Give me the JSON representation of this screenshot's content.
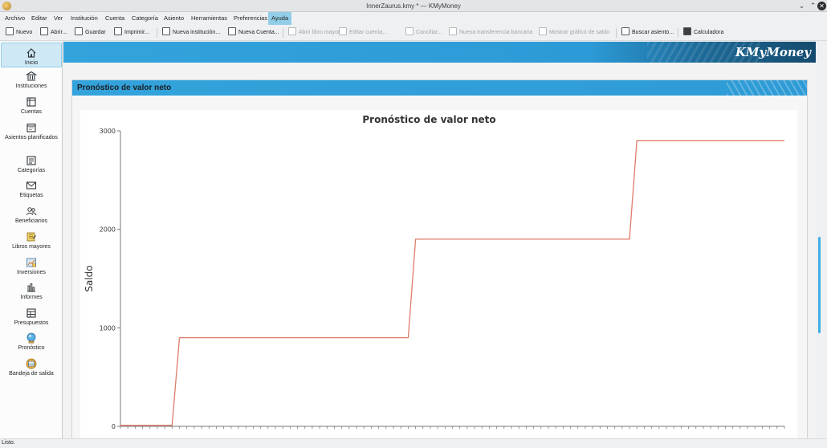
{
  "window": {
    "title": "InnerZaurus.kmy * — KMyMoney"
  },
  "menu": [
    "Archivo",
    "Editar",
    "Ver",
    "Institución",
    "Cuenta",
    "Categoría",
    "Asiento",
    "Herramientas",
    "Preferencias",
    "Ayuda"
  ],
  "toolbar": {
    "nuevo": "Nuevo",
    "abrir": "Abrir...",
    "guardar": "Guardar",
    "imprimir": "Imprimir...",
    "nueva_institucion": "Nueva institución...",
    "nueva_cuenta": "Nueva Cuenta...",
    "abrir_libro_mayor": "Abrir libro mayor",
    "editar_cuenta": "Editar cuenta...",
    "conciliar": "Conciliar...",
    "nueva_transferencia": "Nueva transferencia bancaria",
    "mostrar_grafico": "Mostrar gráfico de saldo",
    "buscar_asiento": "Buscar asiento...",
    "calculadora": "Calculadora"
  },
  "sidebar": {
    "items": [
      {
        "label": "Inicio",
        "icon": "home-icon"
      },
      {
        "label": "Instituciones",
        "icon": "bank-icon"
      },
      {
        "label": "Cuentas",
        "icon": "accounts-icon"
      },
      {
        "label": "Asientos planificados",
        "icon": "calendar-icon"
      },
      {
        "label": "Categorías",
        "icon": "categories-icon"
      },
      {
        "label": "Etiquetas",
        "icon": "tag-icon"
      },
      {
        "label": "Beneficiarios",
        "icon": "payees-icon"
      },
      {
        "label": "Libros mayores",
        "icon": "ledger-icon"
      },
      {
        "label": "Inversiones",
        "icon": "investments-icon"
      },
      {
        "label": "Informes",
        "icon": "reports-icon"
      },
      {
        "label": "Presupuestos",
        "icon": "budget-icon"
      },
      {
        "label": "Pronóstico",
        "icon": "forecast-icon"
      },
      {
        "label": "Bandeja de salida",
        "icon": "outbox-icon"
      }
    ]
  },
  "banner": {
    "logo": "KMyMoney"
  },
  "panel": {
    "title": "Pronóstico de valor neto"
  },
  "chart_data": {
    "type": "line",
    "title": "Pronóstico de valor neto",
    "ylabel": "Saldo",
    "xlabel": "",
    "ylim": [
      0,
      3000
    ],
    "yticks": [
      0,
      1000,
      2000,
      3000
    ],
    "grid": false,
    "series": [
      {
        "color": "#e07b6a",
        "values": [
          10,
          10,
          10,
          10,
          10,
          10,
          10,
          10,
          900,
          900,
          900,
          900,
          900,
          900,
          900,
          900,
          900,
          900,
          900,
          900,
          900,
          900,
          900,
          900,
          900,
          900,
          900,
          900,
          900,
          900,
          900,
          900,
          900,
          900,
          900,
          900,
          900,
          900,
          900,
          900,
          1900,
          1900,
          1900,
          1900,
          1900,
          1900,
          1900,
          1900,
          1900,
          1900,
          1900,
          1900,
          1900,
          1900,
          1900,
          1900,
          1900,
          1900,
          1900,
          1900,
          1900,
          1900,
          1900,
          1900,
          1900,
          1900,
          1900,
          1900,
          1900,
          1900,
          2900,
          2900,
          2900,
          2900,
          2900,
          2900,
          2900,
          2900,
          2900,
          2900,
          2900,
          2900,
          2900,
          2900,
          2900,
          2900,
          2900,
          2900,
          2900,
          2900,
          2900
        ]
      }
    ]
  },
  "statusbar": {
    "text": "Listo."
  }
}
